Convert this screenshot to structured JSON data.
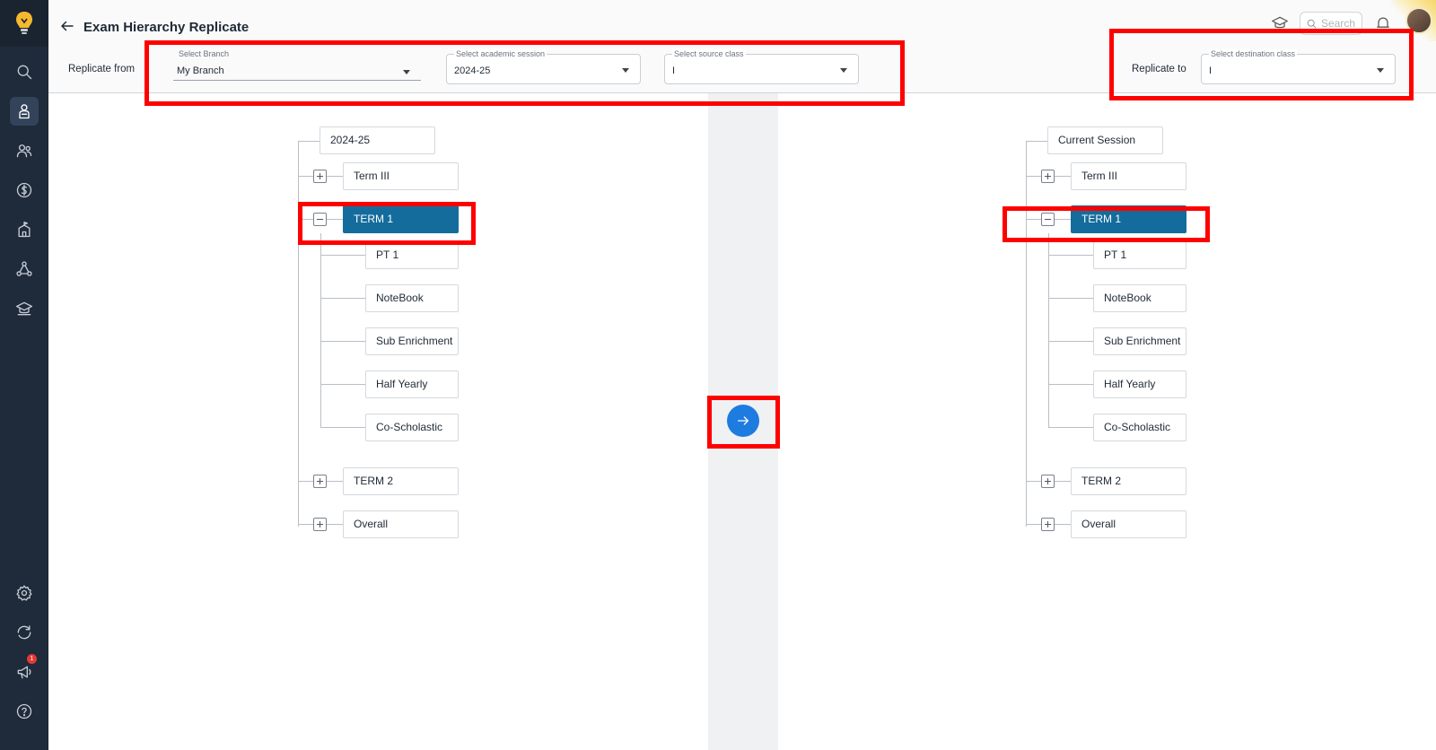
{
  "header": {
    "title": "Exam Hierarchy Replicate",
    "search_placeholder": "Search"
  },
  "source": {
    "row_label": "Replicate from",
    "branch": {
      "legend": "Select Branch",
      "value": "My Branch"
    },
    "session": {
      "legend": "Select academic session",
      "value": "2024-25"
    },
    "class": {
      "legend": "Select source class",
      "value": "I"
    }
  },
  "destination": {
    "row_label": "Replicate to",
    "class": {
      "legend": "Select destination class",
      "value": "I"
    }
  },
  "sidebar": {
    "notification_count": "1"
  },
  "left_tree": {
    "root": "2024-25",
    "terms": [
      {
        "label": "Term III",
        "expanded": false
      },
      {
        "label": "TERM 1",
        "expanded": true,
        "selected": true,
        "children": [
          "PT 1",
          "NoteBook",
          "Sub Enrichment",
          "Half Yearly",
          "Co-Scholastic"
        ]
      },
      {
        "label": "TERM 2",
        "expanded": false
      },
      {
        "label": "Overall",
        "expanded": false
      }
    ]
  },
  "right_tree": {
    "root": "Current Session",
    "terms": [
      {
        "label": "Term III",
        "expanded": false
      },
      {
        "label": "TERM 1",
        "expanded": true,
        "selected": true,
        "children": [
          "PT 1",
          "NoteBook",
          "Sub Enrichment",
          "Half Yearly",
          "Co-Scholastic"
        ]
      },
      {
        "label": "TERM 2",
        "expanded": false
      },
      {
        "label": "Overall",
        "expanded": false
      }
    ]
  },
  "colors": {
    "sidebar_bg": "#1f2a3a",
    "selected_node": "#146c9c",
    "replicate_button": "#1e7be0",
    "highlight": "#ff0000"
  }
}
